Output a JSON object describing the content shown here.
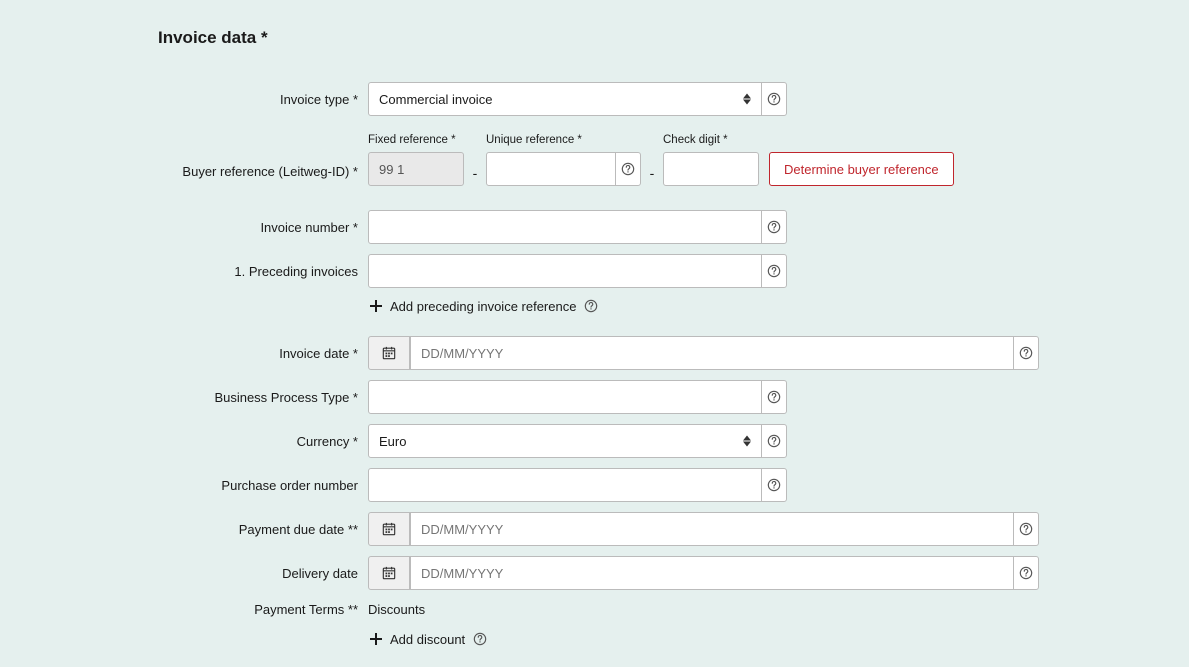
{
  "section_title": "Invoice data *",
  "labels": {
    "invoice_type": "Invoice type *",
    "buyer_reference": "Buyer reference (Leitweg-ID) *",
    "fixed_reference": "Fixed reference *",
    "unique_reference": "Unique reference *",
    "check_digit": "Check digit *",
    "invoice_number": "Invoice number *",
    "preceding_invoices": "1. Preceding invoices",
    "add_preceding": "Add preceding invoice reference",
    "invoice_date": "Invoice date *",
    "business_process_type": "Business Process Type *",
    "currency": "Currency *",
    "purchase_order_number": "Purchase order number",
    "payment_due_date": "Payment due date **",
    "delivery_date": "Delivery date",
    "payment_terms": "Payment Terms **",
    "discounts": "Discounts",
    "add_discount": "Add discount"
  },
  "values": {
    "invoice_type_selected": "Commercial invoice",
    "fixed_reference": "99 1",
    "unique_reference": "",
    "check_digit": "",
    "invoice_number": "",
    "preceding_invoices": "",
    "invoice_date": "",
    "business_process_type": "",
    "currency_selected": "Euro",
    "purchase_order_number": "",
    "payment_due_date": "",
    "delivery_date": ""
  },
  "placeholders": {
    "date": "DD/MM/YYYY"
  },
  "buttons": {
    "determine_buyer_reference": "Determine buyer reference"
  }
}
